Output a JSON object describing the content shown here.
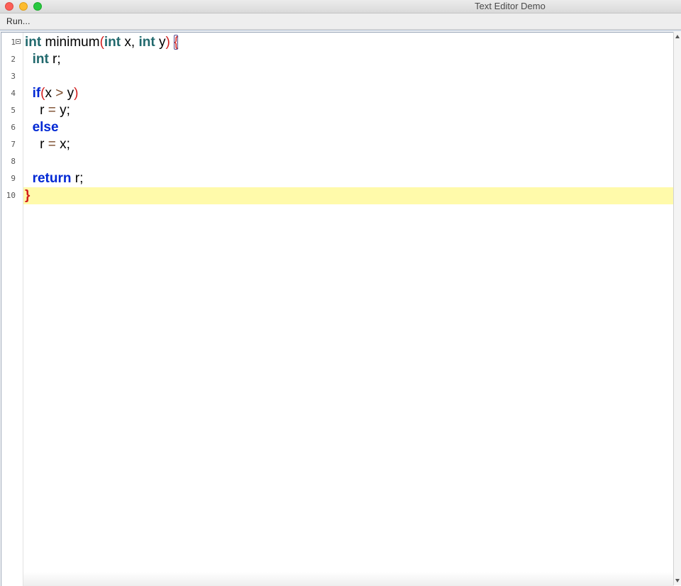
{
  "window": {
    "title": "Text Editor Demo"
  },
  "toolbar": {
    "run_label": "Run..."
  },
  "editor": {
    "line_numbers": [
      "1",
      "2",
      "3",
      "4",
      "5",
      "6",
      "7",
      "8",
      "9",
      "10"
    ],
    "current_line": 10,
    "lines": {
      "l1": {
        "kw1": "int",
        "name": " minimum",
        "open": "(",
        "kw2": "int",
        "a": " x, ",
        "kw3": "int",
        "b": " y",
        "close": ")",
        "sp": " ",
        "brace": "{"
      },
      "l2": {
        "indent": "  ",
        "kw": "int",
        "rest": " r;"
      },
      "l4": {
        "indent": "  ",
        "kw": "if",
        "open": "(",
        "a": "x ",
        "op": ">",
        "b": " y",
        "close": ")"
      },
      "l5": {
        "indent": "    ",
        "a": "r ",
        "op": "=",
        "b": " y;"
      },
      "l6": {
        "indent": "  ",
        "kw": "else"
      },
      "l7": {
        "indent": "    ",
        "a": "r ",
        "op": "=",
        "b": " x;"
      },
      "l9": {
        "indent": "  ",
        "kw": "return",
        "rest": " r;"
      },
      "l10": {
        "brace": "}"
      }
    }
  },
  "colors": {
    "type_keyword": "#21696d",
    "control_keyword": "#0028d4",
    "paren": "#d21c1c",
    "current_line_highlight": "#fffaaa"
  }
}
